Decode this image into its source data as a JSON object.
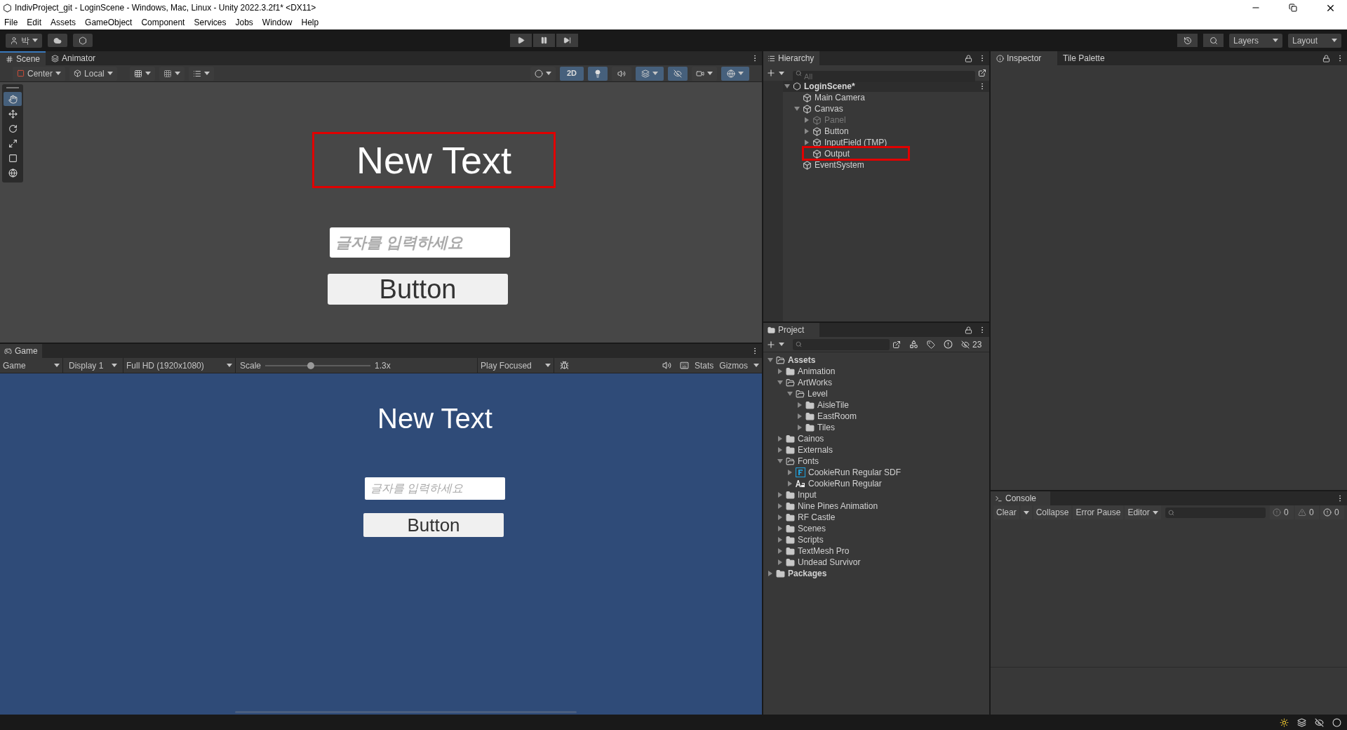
{
  "window": {
    "title": "IndivProject_git - LoginScene - Windows, Mac, Linux - Unity 2022.3.2f1* <DX11>"
  },
  "menu": [
    "File",
    "Edit",
    "Assets",
    "GameObject",
    "Component",
    "Services",
    "Jobs",
    "Window",
    "Help"
  ],
  "toolbar": {
    "account": "박",
    "layers": "Layers",
    "layout": "Layout"
  },
  "scene": {
    "tabs": [
      {
        "label": "Scene",
        "selected": true
      },
      {
        "label": "Animator",
        "selected": false
      }
    ],
    "pivot": "Center",
    "space": "Local",
    "mode_2d": {
      "label": "2D",
      "on": true
    },
    "tools": [
      {
        "kind": "hand",
        "selected": true
      },
      {
        "kind": "move",
        "selected": false
      },
      {
        "kind": "rotate",
        "selected": false
      },
      {
        "kind": "scale",
        "selected": false
      },
      {
        "kind": "rect",
        "selected": false
      },
      {
        "kind": "transform",
        "selected": false
      }
    ],
    "ui": {
      "text": "New Text",
      "text_highlighted": true,
      "placeholder": "글자를 입력하세요",
      "button": "Button"
    }
  },
  "game": {
    "tab": "Game",
    "view": "Game",
    "display": "Display 1",
    "resolution": "Full HD (1920x1080)",
    "scale_label": "Scale",
    "scale": {
      "level": 0.43
    },
    "scale_reading": "1.3x",
    "play_mode": "Play Focused",
    "stats": "Stats",
    "gizmos": "Gizmos",
    "ui": {
      "text": "New Text",
      "placeholder": "글자를 입력하세요",
      "button": "Button"
    }
  },
  "hierarchy": {
    "title": "Hierarchy",
    "search": {
      "placeholder": "All"
    },
    "scene": "LoginScene*",
    "items": [
      {
        "label": "Main Camera",
        "disabled": false,
        "highlighted": false
      },
      {
        "label": "Canvas",
        "disabled": false,
        "highlighted": false,
        "expanded": true,
        "children": [
          {
            "label": "Panel",
            "disabled": true,
            "highlighted": false,
            "expanded": false
          },
          {
            "label": "Button",
            "disabled": false,
            "highlighted": false,
            "expanded": false
          },
          {
            "label": "InputField (TMP)",
            "disabled": false,
            "highlighted": false,
            "expanded": false
          },
          {
            "label": "Output",
            "disabled": false,
            "highlighted": true
          }
        ]
      },
      {
        "label": "EventSystem",
        "disabled": false,
        "highlighted": false
      }
    ]
  },
  "project": {
    "title": "Project",
    "hidden_count": "23",
    "items": [
      {
        "label": "Assets",
        "kind": "folder",
        "bold": true,
        "expanded": true,
        "children": [
          {
            "label": "Animation",
            "kind": "folder",
            "expanded": false
          },
          {
            "label": "ArtWorks",
            "kind": "folder",
            "expanded": true,
            "children": [
              {
                "label": "Level",
                "kind": "folder",
                "expanded": true,
                "children": [
                  {
                    "label": "AisleTile",
                    "kind": "folder",
                    "expanded": false
                  },
                  {
                    "label": "EastRoom",
                    "kind": "folder",
                    "expanded": false
                  },
                  {
                    "label": "Tiles",
                    "kind": "folder",
                    "expanded": false
                  }
                ]
              }
            ]
          },
          {
            "label": "Cainos",
            "kind": "folder",
            "expanded": false
          },
          {
            "label": "Externals",
            "kind": "folder",
            "expanded": false
          },
          {
            "label": "Fonts",
            "kind": "folder",
            "expanded": true,
            "children": [
              {
                "label": "CookieRun Regular SDF",
                "kind": "font_asset",
                "expanded": false
              },
              {
                "label": "CookieRun Regular",
                "kind": "font",
                "expanded": false
              }
            ]
          },
          {
            "label": "Input",
            "kind": "folder",
            "expanded": false
          },
          {
            "label": "Nine Pines Animation",
            "kind": "folder",
            "expanded": false
          },
          {
            "label": "RF Castle",
            "kind": "folder",
            "expanded": false
          },
          {
            "label": "Scenes",
            "kind": "folder",
            "expanded": false
          },
          {
            "label": "Scripts",
            "kind": "folder",
            "expanded": false
          },
          {
            "label": "TextMesh Pro",
            "kind": "folder",
            "expanded": false
          },
          {
            "label": "Undead Survivor",
            "kind": "folder",
            "expanded": false
          }
        ]
      },
      {
        "label": "Packages",
        "kind": "folder",
        "bold": true,
        "expanded": false
      }
    ]
  },
  "inspector": {
    "tabs": [
      {
        "label": "Inspector",
        "selected": true
      },
      {
        "label": "Tile Palette",
        "selected": false
      }
    ]
  },
  "console": {
    "title": "Console",
    "clear": "Clear",
    "collapse": "Collapse",
    "error_pause": "Error Pause",
    "editor": "Editor",
    "counts": [
      {
        "kind": "info",
        "count": "0"
      },
      {
        "kind": "warning",
        "count": "0"
      },
      {
        "kind": "error",
        "count": "0"
      }
    ]
  }
}
